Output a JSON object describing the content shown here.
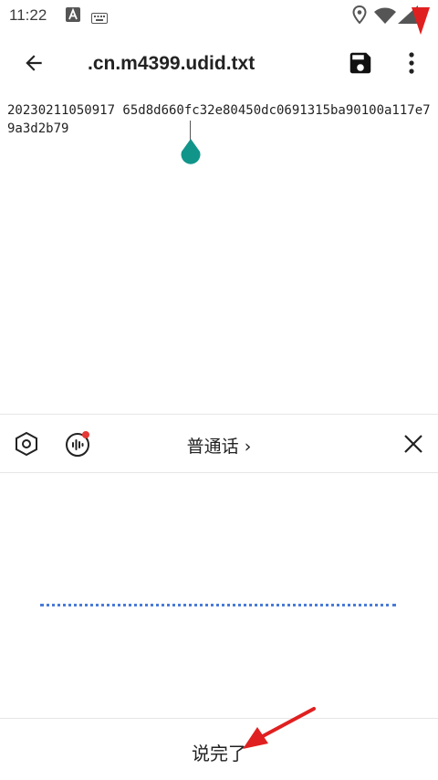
{
  "status_bar": {
    "time": "11:22",
    "icons": [
      "a-notification-icon",
      "keyboard-icon",
      "location-icon",
      "wifi-icon",
      "signal-icon"
    ]
  },
  "app_bar": {
    "title": ".cn.m4399.udid.txt",
    "icons": [
      "back-arrow-icon",
      "save-icon",
      "more-vert-icon"
    ]
  },
  "editor": {
    "text": "20230211050917 65d8d660fc32e80450dc0691315ba90100a117e79a3d2b79"
  },
  "keyboard": {
    "language_label": "普通话 ›",
    "icons": [
      "settings-hexagon-icon",
      "voice-wave-icon",
      "close-icon"
    ],
    "accent": "#e53935"
  },
  "voice": {
    "done_label": "说完了",
    "dot_color": "#4a7bd8"
  },
  "annotations": {
    "arrow_color": "#e02020"
  }
}
